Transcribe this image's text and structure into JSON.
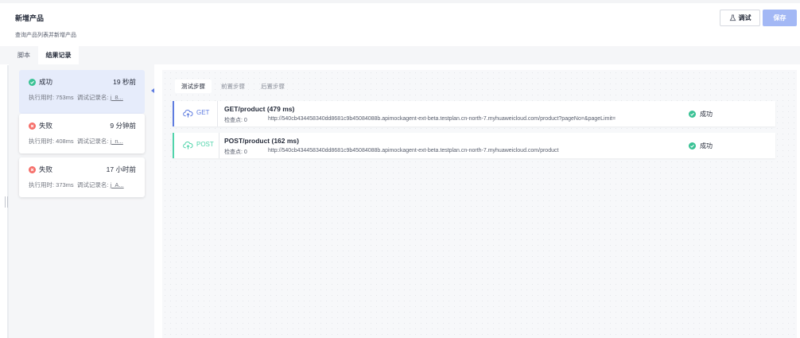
{
  "header": {
    "title": "新增产品",
    "subtitle": "查询产品列表并新增产品",
    "debug_label": "调试",
    "save_label": "保存"
  },
  "tabs": [
    {
      "label": "脚本",
      "active": false
    },
    {
      "label": "结果记录",
      "active": true
    }
  ],
  "records": [
    {
      "status": "成功",
      "status_type": "success",
      "time": "19 秒前",
      "duration": "执行用时: 753ms",
      "record_prefix": "调试记录名:",
      "record_name": "j_8...",
      "active": true
    },
    {
      "status": "失败",
      "status_type": "fail",
      "time": "9 分钟前",
      "duration": "执行用时: 408ms",
      "record_prefix": "调试记录名:",
      "record_name": "j_n...",
      "active": false
    },
    {
      "status": "失败",
      "status_type": "fail",
      "time": "17 小时前",
      "duration": "执行用时: 373ms",
      "record_prefix": "调试记录名:",
      "record_name": "j_A...",
      "active": false
    }
  ],
  "step_tabs": [
    {
      "label": "测试步骤",
      "active": true
    },
    {
      "label": "前置步骤",
      "active": false
    },
    {
      "label": "后置步骤",
      "active": false
    }
  ],
  "requests": [
    {
      "method": "GET",
      "title": "GET/product (479 ms)",
      "checks": "检查点: 0",
      "url": "http://540cb434458340dd8681c9b45084088b.apimockagent-ext-beta.testplan.cn-north-7.myhuaweicloud.com/product?pageNo=&pageLimit=",
      "status": "成功"
    },
    {
      "method": "POST",
      "title": "POST/product (162 ms)",
      "checks": "检查点: 0",
      "url": "http://540cb434458340dd8681c9b45084088b.apimockagent-ext-beta.testplan.cn-north-7.myhuaweicloud.com/product",
      "status": "成功"
    }
  ],
  "icons": {
    "debug": "flask-icon",
    "success": "check-circle-icon",
    "fail": "x-circle-icon",
    "request": "cloud-upload-icon"
  },
  "colors": {
    "primary": "#5e7ce0",
    "save_button": "#a3b8f5",
    "success": "#3ac295",
    "fail": "#f66f6a",
    "post": "#50d4ab"
  }
}
